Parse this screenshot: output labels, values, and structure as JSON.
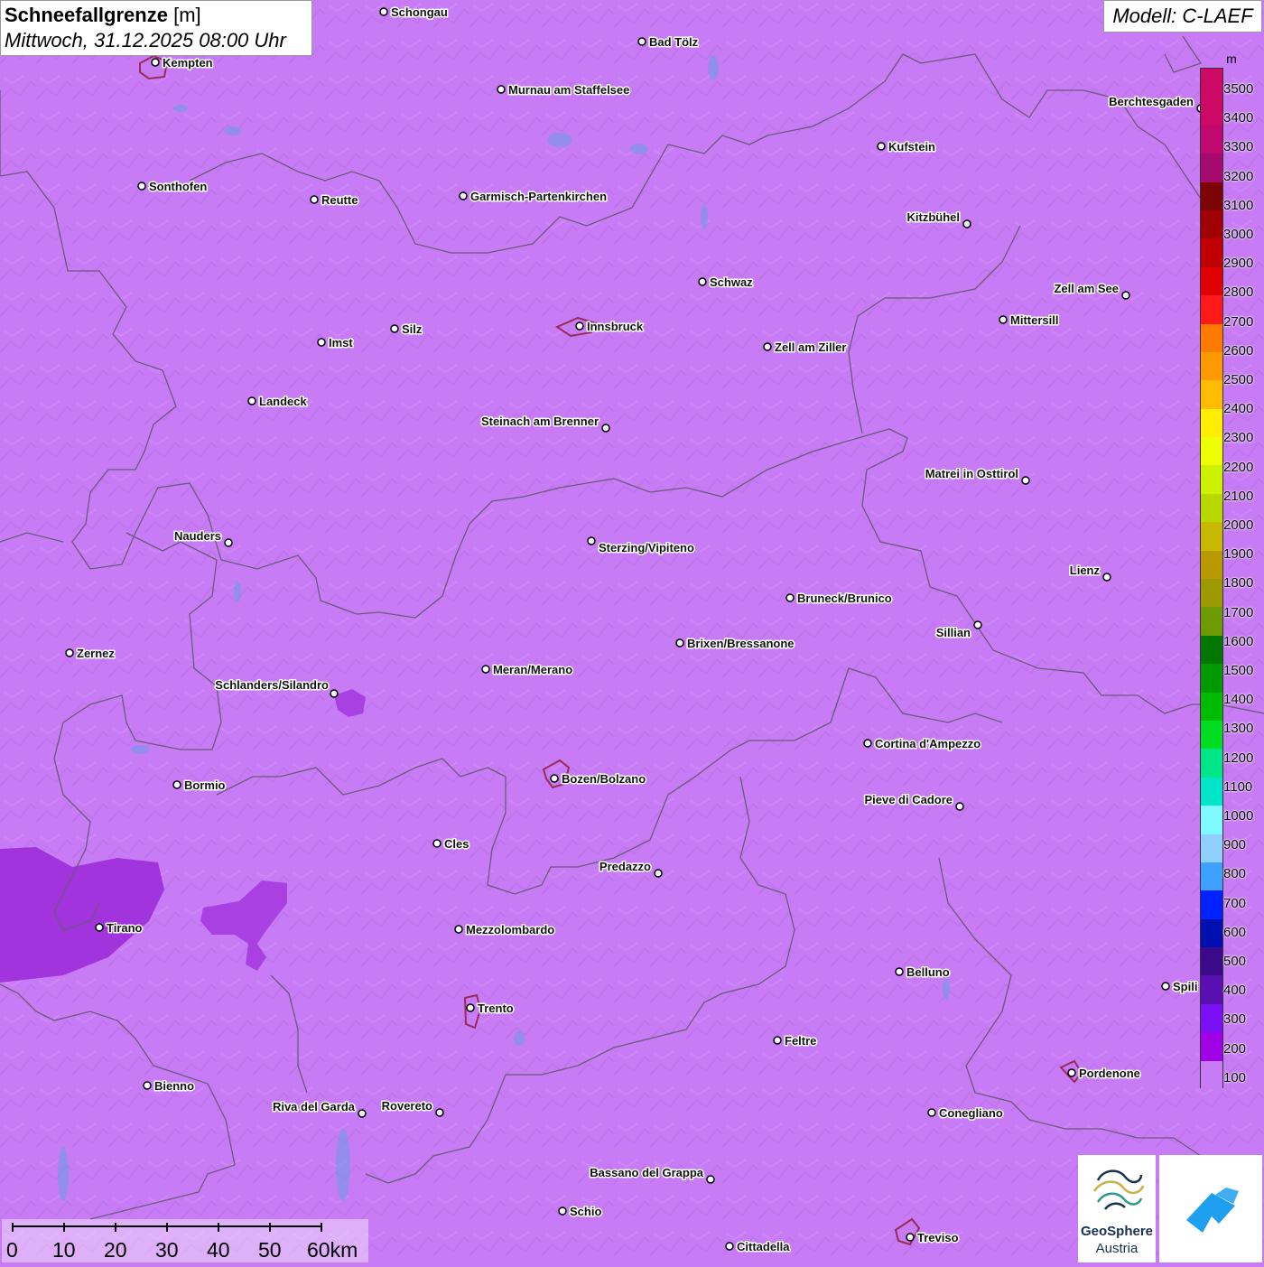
{
  "header": {
    "title": "Schneefallgrenze",
    "unit": "[m]",
    "datetime": "Mittwoch, 31.12.2025 08:00 Uhr",
    "model": "Modell: C-LAEF"
  },
  "legend": {
    "unit": "m",
    "ticks": [
      "3500",
      "3400",
      "3300",
      "3200",
      "3100",
      "3000",
      "2900",
      "2800",
      "2700",
      "2600",
      "2500",
      "2400",
      "2300",
      "2200",
      "2100",
      "2000",
      "1900",
      "1800",
      "1700",
      "1600",
      "1500",
      "1400",
      "1300",
      "1200",
      "1100",
      "1000",
      "900",
      "800",
      "700",
      "600",
      "500",
      "400",
      "300",
      "200",
      "100"
    ],
    "colors": [
      "#cc0a66",
      "#cc0a66",
      "#c1086f",
      "#a50b6e",
      "#7d0404",
      "#a00000",
      "#c00000",
      "#e00000",
      "#ff1a1a",
      "#ff7a00",
      "#ff9900",
      "#ffbb00",
      "#ffee00",
      "#eeff00",
      "#ccf200",
      "#b8d800",
      "#c9b800",
      "#b89a00",
      "#9b9a00",
      "#6c9a00",
      "#007700",
      "#009a00",
      "#00bb00",
      "#00dd22",
      "#00e588",
      "#00e5c8",
      "#7ffbff",
      "#8fd0ff",
      "#3ea0ff",
      "#0022ff",
      "#0010b0",
      "#3a0a8a",
      "#5a10b0",
      "#7a10f5",
      "#9f00e6",
      "#c77cf5"
    ]
  },
  "cities": [
    {
      "name": "Schongau"
    },
    {
      "name": "Bad Tölz"
    },
    {
      "name": "Kempten"
    },
    {
      "name": "Murnau am Staffelsee"
    },
    {
      "name": "Berchtesgaden"
    },
    {
      "name": "Kufstein"
    },
    {
      "name": "Sonthofen"
    },
    {
      "name": "Reutte"
    },
    {
      "name": "Garmisch-Partenkirchen"
    },
    {
      "name": "Kitzbühel"
    },
    {
      "name": "Schwaz"
    },
    {
      "name": "Zell am See"
    },
    {
      "name": "Mittersill"
    },
    {
      "name": "Innsbruck"
    },
    {
      "name": "Silz"
    },
    {
      "name": "Imst"
    },
    {
      "name": "Zell am Ziller"
    },
    {
      "name": "Landeck"
    },
    {
      "name": "Steinach am Brenner"
    },
    {
      "name": "Matrei in Osttirol"
    },
    {
      "name": "Nauders"
    },
    {
      "name": "Sterzing/Vipiteno"
    },
    {
      "name": "Lienz"
    },
    {
      "name": "Bruneck/Brunico"
    },
    {
      "name": "Sillian"
    },
    {
      "name": "Zernez"
    },
    {
      "name": "Brixen/Bressanone"
    },
    {
      "name": "Meran/Merano"
    },
    {
      "name": "Schlanders/Silandro"
    },
    {
      "name": "Cortina d'Ampezzo"
    },
    {
      "name": "Bozen/Bolzano"
    },
    {
      "name": "Bormio"
    },
    {
      "name": "Pieve di Cadore"
    },
    {
      "name": "Cles"
    },
    {
      "name": "Predazzo"
    },
    {
      "name": "Tirano"
    },
    {
      "name": "Mezzolombardo"
    },
    {
      "name": "Belluno"
    },
    {
      "name": "Spili"
    },
    {
      "name": "Trento"
    },
    {
      "name": "Feltre"
    },
    {
      "name": "Pordenone"
    },
    {
      "name": "Bienno"
    },
    {
      "name": "Riva del Garda"
    },
    {
      "name": "Rovereto"
    },
    {
      "name": "Conegliano"
    },
    {
      "name": "Bassano del Grappa"
    },
    {
      "name": "Schio"
    },
    {
      "name": "Treviso"
    },
    {
      "name": "Cittadella"
    }
  ],
  "scale_bar": {
    "labels": [
      "0",
      "10",
      "20",
      "30",
      "40",
      "50",
      "60km"
    ]
  },
  "logos": {
    "geosphere_line1": "GeoSphere",
    "geosphere_line2": "Austria"
  }
}
